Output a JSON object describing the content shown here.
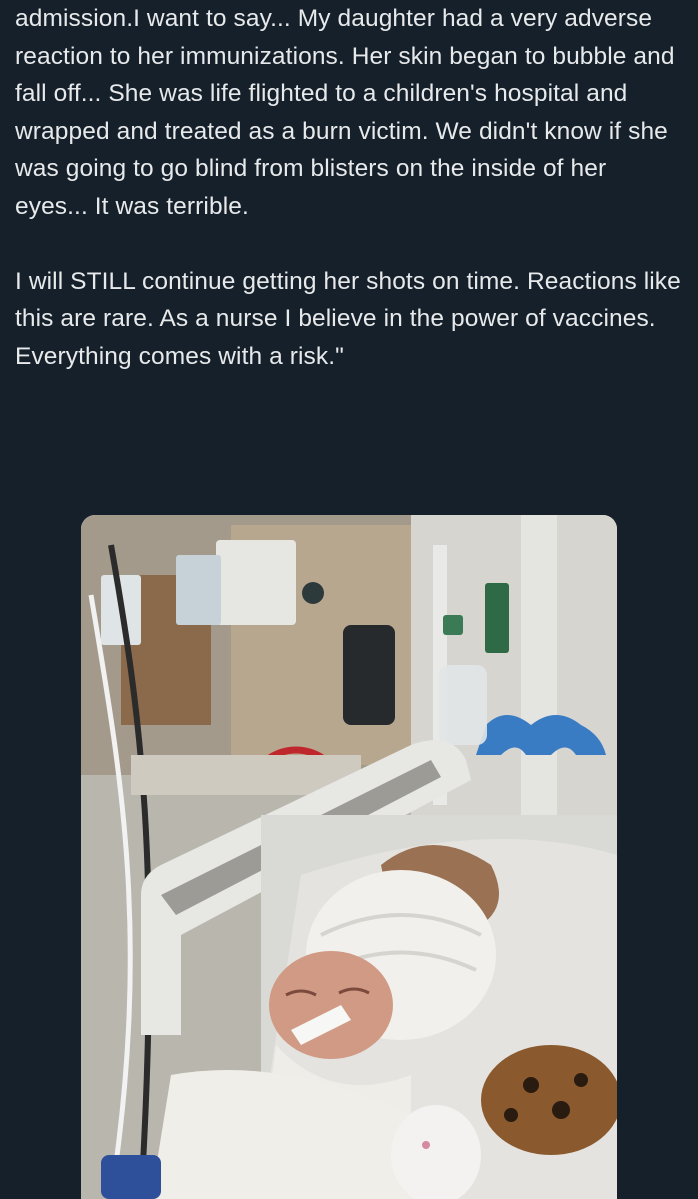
{
  "post": {
    "paragraphs": [
      "admission.I want to say... My daughter had a very adverse reaction to her immunizations. Her skin began to bubble and fall off... She was life flighted to a children's hospital and wrapped and treated as a burn victim. We didn't know if she was going to go blind from blisters on the inside of her eyes... It was terrible.",
      "I will STILL continue getting her shots on time. Reactions like this are rare. As a nurse I believe in the power of vaccines. Everything comes with a risk.\""
    ]
  },
  "colors": {
    "background": "#15202b",
    "text": "#e7e9ea"
  }
}
